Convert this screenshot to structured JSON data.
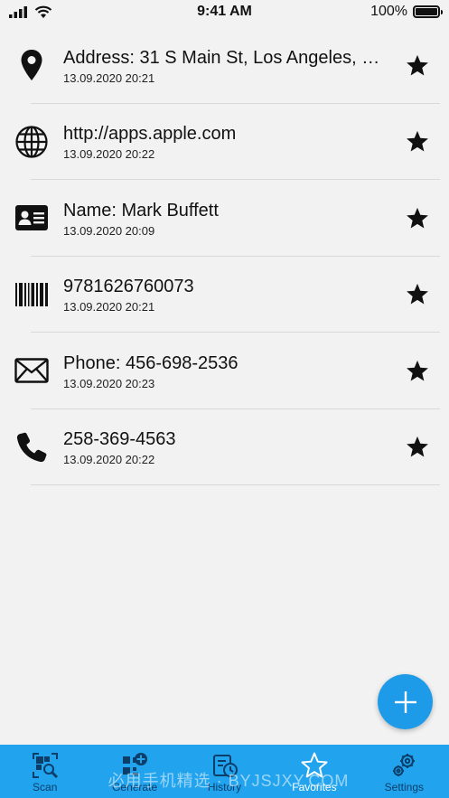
{
  "status_bar": {
    "time": "9:41 AM",
    "battery": "100%"
  },
  "favorites": [
    {
      "icon": "location-pin-icon",
      "title": "Address: 31 S Main St, Los Angeles, 9...",
      "date": "13.09.2020 20:21"
    },
    {
      "icon": "globe-icon",
      "title": "http://apps.apple.com",
      "date": "13.09.2020 20:22"
    },
    {
      "icon": "contact-card-icon",
      "title": "Name: Mark Buffett",
      "date": "13.09.2020 20:09"
    },
    {
      "icon": "barcode-icon",
      "title": "9781626760073",
      "date": "13.09.2020 20:21"
    },
    {
      "icon": "envelope-icon",
      "title": "Phone: 456-698-2536",
      "date": "13.09.2020 20:23"
    },
    {
      "icon": "phone-icon",
      "title": "258-369-4563",
      "date": "13.09.2020 20:22"
    }
  ],
  "fab": {
    "icon": "plus-icon"
  },
  "tabs": [
    {
      "label": "Scan",
      "icon": "scan-icon",
      "active": false
    },
    {
      "label": "Generate",
      "icon": "generate-icon",
      "active": false
    },
    {
      "label": "History",
      "icon": "history-icon",
      "active": false
    },
    {
      "label": "Favorites",
      "icon": "star-outline-icon",
      "active": true
    },
    {
      "label": "Settings",
      "icon": "gears-icon",
      "active": false
    }
  ],
  "watermark": "必用手机精选 · BYJSJXY.COM",
  "colors": {
    "tabbar": "#21a3ee",
    "fab": "#1e9be8",
    "background": "#f2f2f2",
    "tab_inactive": "#0c3e6a"
  }
}
